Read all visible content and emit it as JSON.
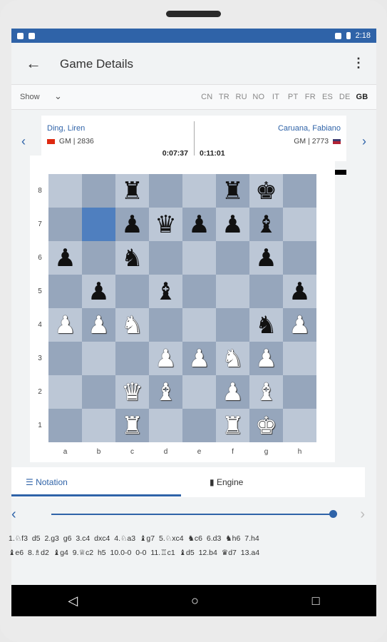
{
  "status": {
    "time": "2:18"
  },
  "app": {
    "title": "Game Details"
  },
  "langbar": {
    "show_label": "Show",
    "languages": [
      "CN",
      "TR",
      "RU",
      "NO",
      "IT",
      "PT",
      "FR",
      "ES",
      "DE",
      "GB"
    ],
    "active": "GB"
  },
  "white_player": {
    "name": "Ding, Liren",
    "rating": "GM | 2836",
    "clock": "0:07:37",
    "flag_color": "#de2910"
  },
  "black_player": {
    "name": "Caruana, Fabiano",
    "rating": "GM | 2773",
    "clock": "0:11:01",
    "flag_color": "#3c3b6e"
  },
  "board": {
    "ranks": [
      "8",
      "7",
      "6",
      "5",
      "4",
      "3",
      "2",
      "1"
    ],
    "files": [
      "a",
      "b",
      "c",
      "d",
      "e",
      "f",
      "g",
      "h"
    ],
    "highlight": "b7",
    "position": [
      [
        "",
        "",
        "r",
        "",
        "",
        "r",
        "k",
        ""
      ],
      [
        "",
        "",
        "p",
        "q",
        "p",
        "p",
        "b",
        ""
      ],
      [
        "p",
        "",
        "n",
        "",
        "",
        "",
        "p",
        ""
      ],
      [
        "",
        "p",
        "",
        "b",
        "",
        "",
        "",
        "p"
      ],
      [
        "P",
        "P",
        "N",
        "",
        "",
        "",
        "n",
        "P"
      ],
      [
        "",
        "",
        "",
        "P",
        "P",
        "N",
        "P",
        ""
      ],
      [
        "",
        "",
        "Q",
        "B",
        "",
        "P",
        "B",
        ""
      ],
      [
        "",
        "",
        "R",
        "",
        "",
        "R",
        "K",
        ""
      ]
    ]
  },
  "tabs": {
    "notation": "Notation",
    "engine": "Engine"
  },
  "moves": {
    "line1": "1.♘f3  d5  2.g3  g6  3.c4  dxc4  4.♘a3  ♝g7  5.♘xc4  ♞c6  6.d3  ♞h6  7.h4",
    "line2": "♝e6  8.♗d2  ♝g4  9.♕c2  h5  10.0-0  0-0  11.♖c1  ♝d5  12.b4  ♛d7  13.a4"
  }
}
